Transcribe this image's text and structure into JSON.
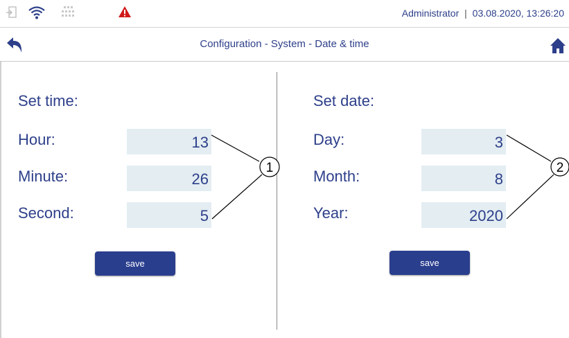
{
  "colors": {
    "accent": "#2d3f8a",
    "button": "#2a3e8e",
    "field_bg": "#e3edf2",
    "warning": "#d11a1a"
  },
  "statusbar": {
    "icons": [
      "logout-icon",
      "wifi-icon",
      "network-icon",
      "warning-icon"
    ],
    "user": "Administrator",
    "separator": "|",
    "datetime": "03.08.2020, 13:26:20"
  },
  "nav": {
    "title": "Configuration - System - Date & time",
    "back_icon": "back-arrow-icon",
    "home_icon": "home-icon"
  },
  "time": {
    "heading": "Set time:",
    "hour_label": "Hour:",
    "hour_value": "13",
    "minute_label": "Minute:",
    "minute_value": "26",
    "second_label": "Second:",
    "second_value": "5",
    "save_label": "save",
    "callout": "1"
  },
  "date": {
    "heading": "Set date:",
    "day_label": "Day:",
    "day_value": "3",
    "month_label": "Month:",
    "month_value": "8",
    "year_label": "Year:",
    "year_value": "2020",
    "save_label": "save",
    "callout": "2"
  }
}
